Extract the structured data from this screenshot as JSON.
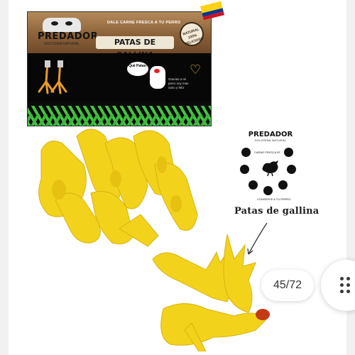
{
  "product": {
    "brand": "PREDADOR",
    "brand_sub": "GOLOSINA NATURAL",
    "tagline": "DALE CARNE FRESCA A TU PERRO",
    "title": "PATAS DE GALLINA",
    "badge": "NATURAL 100% DELICIOSO",
    "bubble": "Qué Patas!",
    "pack_text": "Gracias a mi perro soy mas sano y feliz"
  },
  "info": {
    "brand": "PREDADOR",
    "brand_sub": "GOLOSINA NATURAL",
    "top_label": "CARNE FRESCA IR",
    "bottom_label": "CONSERVE A TU PERRO",
    "caption": "Patas de gallina"
  },
  "viewer": {
    "counter": "45/72",
    "grid_icon": "grid-dots-icon"
  },
  "colors": {
    "accent_green": "#41c640",
    "feet_yellow": "#f3d21c",
    "flag_yellow": "#fcd116",
    "flag_blue": "#003893",
    "flag_red": "#ce1126"
  }
}
